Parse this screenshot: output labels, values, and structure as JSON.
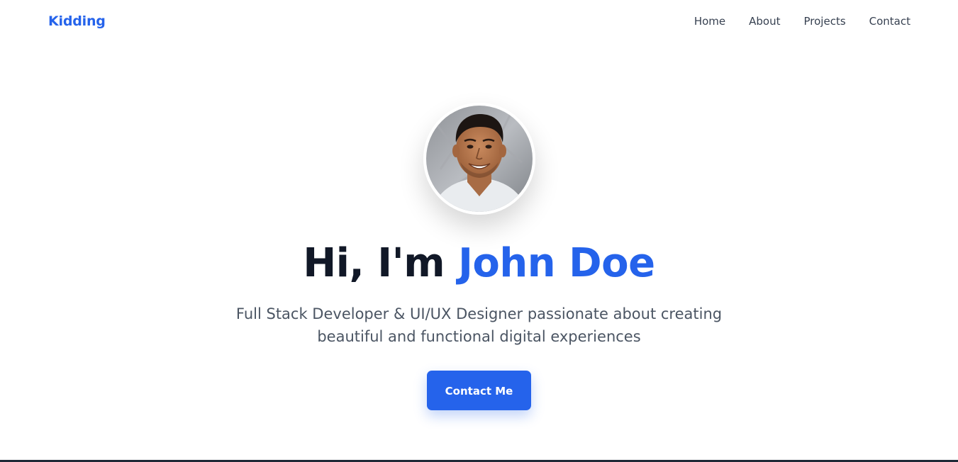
{
  "nav": {
    "brand": "Kidding",
    "links": [
      "Home",
      "About",
      "Projects",
      "Contact"
    ]
  },
  "hero": {
    "greeting": "Hi, I'm",
    "name": "John Doe",
    "subtitle_line1": "Full Stack Developer & UI/UX Designer passionate about creating",
    "subtitle_line2": "beautiful and functional digital experiences",
    "cta_label": "Contact Me"
  },
  "colors": {
    "accent": "#2563eb",
    "heading": "#111827",
    "text": "#4b5563",
    "nav_text": "#374151"
  }
}
